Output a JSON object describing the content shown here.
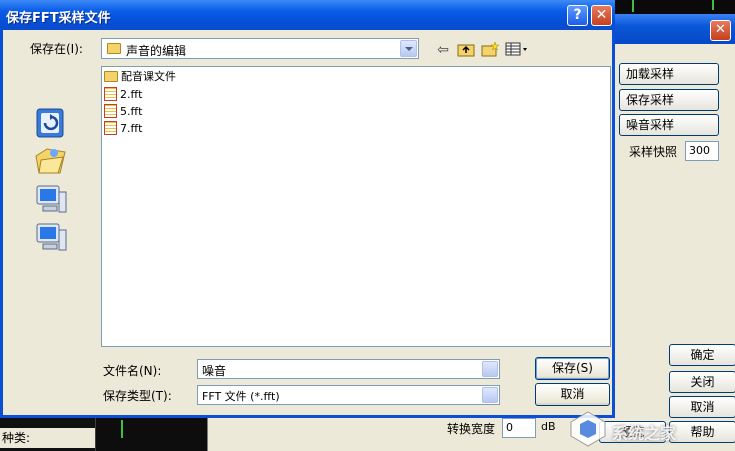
{
  "dialog": {
    "title": "保存FFT采样文件",
    "help_glyph": "?",
    "close_glyph": "✕",
    "save_in_label": "保存在(I):",
    "save_in_value": "声音的编辑",
    "file_list": [
      {
        "name": "配音课文件",
        "type": "folder"
      },
      {
        "name": "2.fft",
        "type": "fft"
      },
      {
        "name": "5.fft",
        "type": "fft"
      },
      {
        "name": "7.fft",
        "type": "fft"
      }
    ],
    "filename_label": "文件名(N):",
    "filename_value": "噪音",
    "filetype_label": "保存类型(T):",
    "filetype_value": "FFT 文件 (*.fft)",
    "save_button": "保存(S)",
    "cancel_button": "取消"
  },
  "bg_window": {
    "close_glyph": "✕",
    "load_sample": "加载采样",
    "save_sample": "保存采样",
    "noise_sample": "噪音采样",
    "snapshot_label": "采样快照",
    "snapshot_value": "300",
    "ok": "确定",
    "close": "关闭",
    "cancel": "取消",
    "preview": "预览",
    "help": "帮助",
    "width_label": "转换宽度",
    "width_value": "0",
    "db_unit": "dB",
    "kind_label": "种类:"
  },
  "watermark": {
    "text": "系统之家"
  }
}
